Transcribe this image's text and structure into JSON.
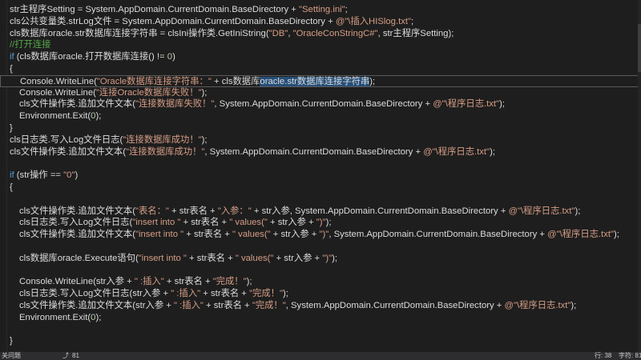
{
  "editor": {
    "lines": [
      {
        "indent": 12,
        "tokens": [
          {
            "t": "str主程序Setting = System.AppDomain.CurrentDomain.BaseDirectory + ",
            "c": "plain"
          },
          {
            "t": "\"Setting.ini\"",
            "c": "str"
          },
          {
            "t": ";",
            "c": "plain"
          }
        ]
      },
      {
        "indent": 12,
        "tokens": [
          {
            "t": "cls公共变量类.strLog文件 = System.AppDomain.CurrentDomain.BaseDirectory + ",
            "c": "plain"
          },
          {
            "t": "@\"\\插入HISlog.txt\"",
            "c": "str"
          },
          {
            "t": ";",
            "c": "plain"
          }
        ]
      },
      {
        "indent": 12,
        "tokens": [
          {
            "t": "cls数据库oracle.str数据库连接字符串 = clsIni操作类.GetIniString(",
            "c": "plain"
          },
          {
            "t": "\"DB\"",
            "c": "str"
          },
          {
            "t": ", ",
            "c": "plain"
          },
          {
            "t": "\"OracleConStringC#\"",
            "c": "str"
          },
          {
            "t": ", str主程序Setting);",
            "c": "plain"
          }
        ]
      },
      {
        "indent": 12,
        "tokens": [
          {
            "t": "//打开连接",
            "c": "cm"
          }
        ]
      },
      {
        "indent": 12,
        "tokens": [
          {
            "t": "if",
            "c": "kw"
          },
          {
            "t": " (cls数据库oracle.打开数据库连接() != ",
            "c": "plain"
          },
          {
            "t": "0",
            "c": "num"
          },
          {
            "t": ")",
            "c": "plain"
          }
        ]
      },
      {
        "indent": 12,
        "tokens": [
          {
            "t": "{",
            "c": "plain"
          }
        ]
      },
      {
        "indent": 24,
        "current": true,
        "tokens": [
          {
            "t": "Console.WriteLine(",
            "c": "plain"
          },
          {
            "t": "\"Oracle数据库连接字符串：\"",
            "c": "str"
          },
          {
            "t": " + cls数据库",
            "c": "plain"
          },
          {
            "t": "oracle.str数据库连接字符串",
            "c": "sel"
          },
          {
            "t": ");",
            "c": "plain"
          }
        ]
      },
      {
        "indent": 24,
        "tokens": [
          {
            "t": "Console.WriteLine(",
            "c": "plain"
          },
          {
            "t": "\"连接Oracle数据库失败！\"",
            "c": "str"
          },
          {
            "t": ");",
            "c": "plain"
          }
        ]
      },
      {
        "indent": 24,
        "tokens": [
          {
            "t": "cls文件操作类.追加文件文本(",
            "c": "plain"
          },
          {
            "t": "\"连接数据库失败！\"",
            "c": "str"
          },
          {
            "t": ", System.AppDomain.CurrentDomain.BaseDirectory + ",
            "c": "plain"
          },
          {
            "t": "@\"\\程序日志.txt\"",
            "c": "str"
          },
          {
            "t": ");",
            "c": "plain"
          }
        ]
      },
      {
        "indent": 24,
        "tokens": [
          {
            "t": "Environment.Exit(",
            "c": "plain"
          },
          {
            "t": "0",
            "c": "num"
          },
          {
            "t": ");",
            "c": "plain"
          }
        ]
      },
      {
        "indent": 12,
        "tokens": [
          {
            "t": "}",
            "c": "plain"
          }
        ]
      },
      {
        "indent": 12,
        "tokens": [
          {
            "t": "cls日志类.写入Log文件日志(",
            "c": "plain"
          },
          {
            "t": "\"连接数据库成功！\"",
            "c": "str"
          },
          {
            "t": ");",
            "c": "plain"
          }
        ]
      },
      {
        "indent": 12,
        "tokens": [
          {
            "t": "cls文件操作类.追加文件文本(",
            "c": "plain"
          },
          {
            "t": "\"连接数据库成功！\"",
            "c": "str"
          },
          {
            "t": ", System.AppDomain.CurrentDomain.BaseDirectory + ",
            "c": "plain"
          },
          {
            "t": "@\"\\程序日志.txt\"",
            "c": "str"
          },
          {
            "t": ");",
            "c": "plain"
          }
        ]
      },
      {
        "indent": 12,
        "tokens": []
      },
      {
        "indent": 12,
        "tokens": [
          {
            "t": "if",
            "c": "kw"
          },
          {
            "t": " (str操作 == ",
            "c": "plain"
          },
          {
            "t": "\"0\"",
            "c": "str"
          },
          {
            "t": ")",
            "c": "plain"
          }
        ]
      },
      {
        "indent": 12,
        "tokens": [
          {
            "t": "{",
            "c": "plain"
          }
        ]
      },
      {
        "indent": 12,
        "tokens": []
      },
      {
        "indent": 24,
        "tokens": [
          {
            "t": "cls文件操作类.追加文件文本(",
            "c": "plain"
          },
          {
            "t": "\"表名：\"",
            "c": "str"
          },
          {
            "t": " + str表名 + ",
            "c": "plain"
          },
          {
            "t": "\"入参：\"",
            "c": "str"
          },
          {
            "t": " + str入参, System.AppDomain.CurrentDomain.BaseDirectory + ",
            "c": "plain"
          },
          {
            "t": "@\"\\程序日志.txt\"",
            "c": "str"
          },
          {
            "t": ");",
            "c": "plain"
          }
        ]
      },
      {
        "indent": 24,
        "tokens": [
          {
            "t": "cls日志类.写入Log文件日志(",
            "c": "plain"
          },
          {
            "t": "\"insert into \"",
            "c": "str"
          },
          {
            "t": " + str表名 + ",
            "c": "plain"
          },
          {
            "t": "\" values(\"",
            "c": "str"
          },
          {
            "t": " + str入参 + ",
            "c": "plain"
          },
          {
            "t": "\")\"",
            "c": "str"
          },
          {
            "t": ");",
            "c": "plain"
          }
        ]
      },
      {
        "indent": 24,
        "tokens": [
          {
            "t": "cls文件操作类.追加文件文本(",
            "c": "plain"
          },
          {
            "t": "\"insert into \"",
            "c": "str"
          },
          {
            "t": " + str表名 + ",
            "c": "plain"
          },
          {
            "t": "\" values(\"",
            "c": "str"
          },
          {
            "t": " + str入参 + ",
            "c": "plain"
          },
          {
            "t": "\")\"",
            "c": "str"
          },
          {
            "t": ", System.AppDomain.CurrentDomain.BaseDirectory + ",
            "c": "plain"
          },
          {
            "t": "@\"\\程序日志.txt\"",
            "c": "str"
          },
          {
            "t": ");",
            "c": "plain"
          }
        ]
      },
      {
        "indent": 12,
        "tokens": []
      },
      {
        "indent": 24,
        "tokens": [
          {
            "t": "cls数据库oracle.Execute语句(",
            "c": "plain"
          },
          {
            "t": "\"insert into \"",
            "c": "str"
          },
          {
            "t": " + str表名 + ",
            "c": "plain"
          },
          {
            "t": "\" values(\"",
            "c": "str"
          },
          {
            "t": " + str入参 + ",
            "c": "plain"
          },
          {
            "t": "\")\"",
            "c": "str"
          },
          {
            "t": ");",
            "c": "plain"
          }
        ]
      },
      {
        "indent": 12,
        "tokens": []
      },
      {
        "indent": 24,
        "tokens": [
          {
            "t": "Console.WriteLine(str入参 + ",
            "c": "plain"
          },
          {
            "t": "\" :插入\"",
            "c": "str"
          },
          {
            "t": " + str表名 + ",
            "c": "plain"
          },
          {
            "t": "\"完成！\"",
            "c": "str"
          },
          {
            "t": ");",
            "c": "plain"
          }
        ]
      },
      {
        "indent": 24,
        "tokens": [
          {
            "t": "cls日志类.写入Log文件日志(str入参 + ",
            "c": "plain"
          },
          {
            "t": "\" :插入\"",
            "c": "str"
          },
          {
            "t": " + str表名 + ",
            "c": "plain"
          },
          {
            "t": "\"完成！\"",
            "c": "str"
          },
          {
            "t": ");",
            "c": "plain"
          }
        ]
      },
      {
        "indent": 24,
        "tokens": [
          {
            "t": "cls文件操作类.追加文件文本(str入参 + ",
            "c": "plain"
          },
          {
            "t": "\" :插入\"",
            "c": "str"
          },
          {
            "t": " + str表名 + ",
            "c": "plain"
          },
          {
            "t": "\"完成！\"",
            "c": "str"
          },
          {
            "t": ", System.AppDomain.CurrentDomain.BaseDirectory + ",
            "c": "plain"
          },
          {
            "t": "@\"\\程序日志.txt\"",
            "c": "str"
          },
          {
            "t": ");",
            "c": "plain"
          }
        ]
      },
      {
        "indent": 24,
        "tokens": [
          {
            "t": "Environment.Exit(",
            "c": "plain"
          },
          {
            "t": "0",
            "c": "num"
          },
          {
            "t": ");",
            "c": "plain"
          }
        ]
      },
      {
        "indent": 12,
        "tokens": []
      },
      {
        "indent": 12,
        "tokens": [
          {
            "t": "}",
            "c": "plain"
          }
        ]
      }
    ]
  },
  "statusbar": {
    "left_text": "关问题",
    "branch_icon": "branch-icon",
    "zoom_text": "81",
    "line_text": "行: 38",
    "col_text": "字符: 81"
  },
  "colors": {
    "background": "#1e1e1e",
    "keyword": "#569cd6",
    "string": "#d69d85",
    "comment": "#57a64a",
    "number": "#b5cea8",
    "text": "#dcdcdc"
  }
}
